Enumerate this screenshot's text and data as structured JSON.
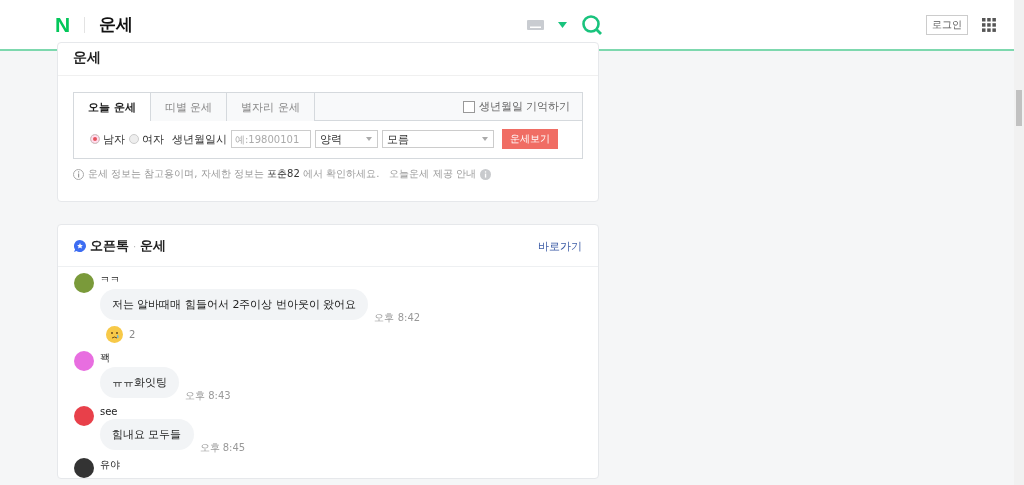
{
  "header": {
    "logo": "N",
    "title": "운세",
    "login": "로그인"
  },
  "fortune": {
    "title": "운세",
    "tabs": [
      {
        "label": "오늘 운세",
        "selected": true
      },
      {
        "label": "띠별 운세",
        "selected": false
      },
      {
        "label": "별자리 운세",
        "selected": false
      }
    ],
    "remember": {
      "label": "생년월일 기억하기",
      "checked": false
    },
    "genders": [
      {
        "label": "남자",
        "selected": true
      },
      {
        "label": "여자",
        "selected": false
      }
    ],
    "birth_label": "생년월일시",
    "birth_placeholder": "예:19800101",
    "calendar": "양력",
    "time": "모름",
    "submit": "운세보기",
    "note_before": "운세 정보는 참고용이며, 자세한 정보는 ",
    "note_link": "포춘82",
    "note_after": " 에서 확인하세요.",
    "provider": "오늘운세 제공 안내"
  },
  "opentalk": {
    "title": "오픈톡",
    "separator": "·",
    "topic": "운세",
    "more": "바로가기",
    "messages": [
      {
        "name": "ㅋㅋ",
        "color": "#7a9a3a",
        "text": "저는 알바때매 힘들어서 2주이상 번아웃이 왔어요",
        "time": "오후 8:42",
        "reaction_count": "2"
      },
      {
        "name": "꽥",
        "color": "#e86ee0",
        "text": "ㅠㅠ화잇팅",
        "time": "오후 8:43"
      },
      {
        "name": "see",
        "color": "#e8404a",
        "text": "힘내요 모두들",
        "time": "오후 8:45"
      },
      {
        "name": "유야",
        "color": "#333333"
      }
    ]
  }
}
